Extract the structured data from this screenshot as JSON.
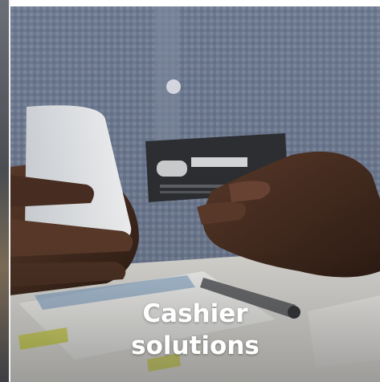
{
  "card": {
    "title_line1": "Cashier",
    "title_line2": "solutions",
    "image_icon": "photo-person-holding-phone-and-credit-card",
    "colors": {
      "text": "#ffffff",
      "shirt": "#6f7c92",
      "table": "#e9e8e4",
      "card": "#2d2f33"
    }
  }
}
